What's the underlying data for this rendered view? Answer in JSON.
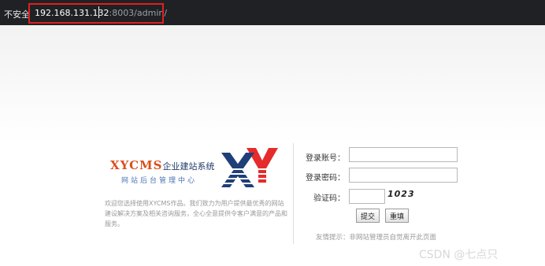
{
  "browser": {
    "security_label": "不安全",
    "url_host": "192.168.131.132",
    "url_rest": ":8003/admin/"
  },
  "logo": {
    "brand": "XYCMS",
    "brand_suffix": "企业建站系统",
    "subtitle": "网站后台管理中心",
    "mark_colors": {
      "x": "#1f3f7a",
      "y": "#e52b2b"
    }
  },
  "intro_text": "欢迎您选择使用XYCMS作品。我们致力为用户提供最优秀的网站建设解决方案及相关咨询服务，全心全意提供令客户满意的产品和服务。",
  "login_form": {
    "username_label": "登录账号：",
    "password_label": "登录密码：",
    "captcha_label": "验证码：",
    "captcha_value": "1023",
    "submit_label": "提交",
    "reset_label": "重填",
    "tip": "友情提示：非网站管理员自觉离开此页面"
  },
  "watermark": "CSDN @七点只"
}
